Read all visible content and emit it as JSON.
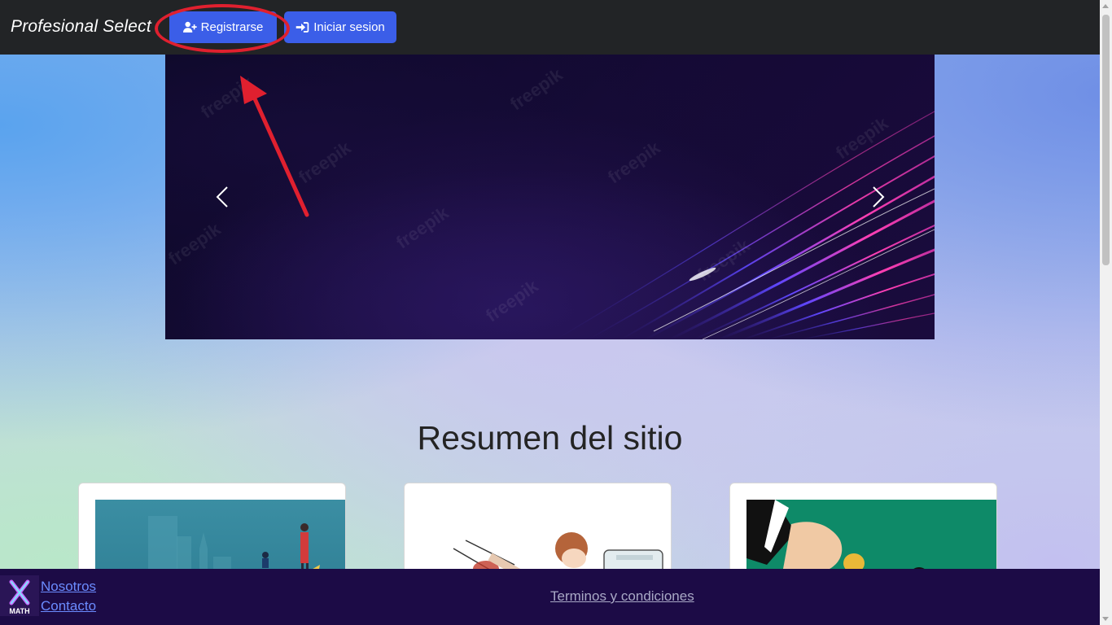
{
  "navbar": {
    "brand": "Profesional Select",
    "register_label": "Registrarse",
    "login_label": "Iniciar sesion"
  },
  "carousel": {
    "watermark": "freepik"
  },
  "main": {
    "section_title": "Resumen del sitio"
  },
  "footer": {
    "logo_text": "X MATH",
    "links": [
      "Nosotros",
      "Contacto"
    ],
    "terms": "Terminos y condiciones"
  },
  "colors": {
    "navbar": "#222426",
    "button": "#3b5ee8",
    "footer": "#1c0b46",
    "annotation": "#e0202f",
    "link": "#6b8cff"
  },
  "icons": {
    "register": "user-plus-icon",
    "login": "sign-in-icon",
    "prev": "chevron-left-icon",
    "next": "chevron-right-icon"
  }
}
